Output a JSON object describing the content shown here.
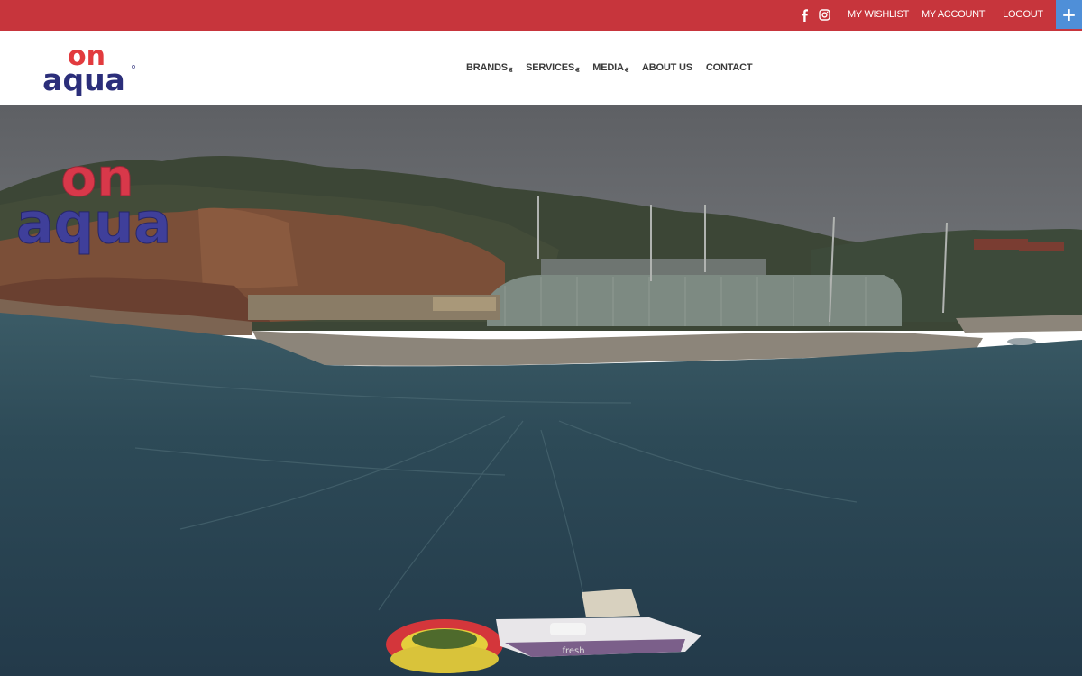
{
  "topbar": {
    "social_icons": [
      "facebook-icon",
      "instagram-icon"
    ],
    "links": {
      "wishlist": "MY WISHLIST",
      "account": "MY ACCOUNT",
      "logout": "LOGOUT"
    },
    "plus_label": "+"
  },
  "header": {
    "logo_top": "on",
    "logo_bottom": "aqua",
    "nav": [
      {
        "label": "BRANDS",
        "has_dropdown": true
      },
      {
        "label": "SERVICES",
        "has_dropdown": true
      },
      {
        "label": "MEDIA",
        "has_dropdown": true
      },
      {
        "label": "ABOUT US",
        "has_dropdown": false
      },
      {
        "label": "CONTACT",
        "has_dropdown": false
      }
    ]
  },
  "hero": {
    "overlay_logo_top": "on",
    "overlay_logo_bottom": "aqua",
    "boat_name": "fresh"
  },
  "colors": {
    "topbar": "#c7353c",
    "accent_blue": "#4f8fd8",
    "logo_red": "#e23b3e",
    "logo_navy": "#2b2e7a"
  }
}
